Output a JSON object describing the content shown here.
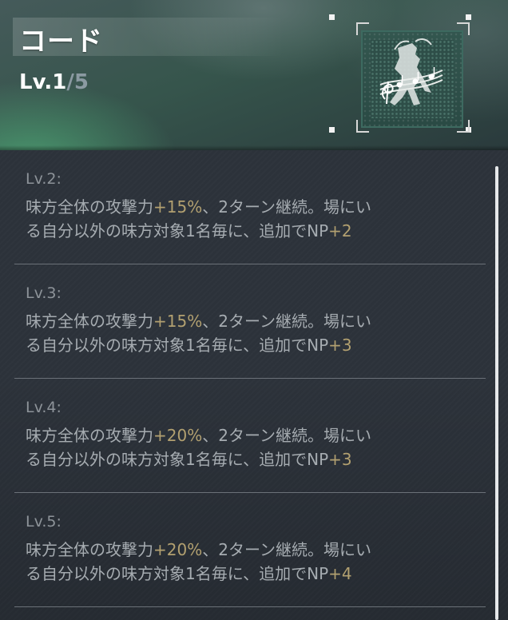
{
  "skill": {
    "name": "コード",
    "level_label": "Lv.1",
    "level_max": "/5",
    "icon": "music-note-figure-icon"
  },
  "levels": [
    {
      "label": "Lv.2:",
      "line1_pre": "味方全体の攻撃力",
      "line1_bonus": "+15%",
      "line1_post": "、2ターン継続。場にい",
      "line2_pre": "る自分以外の味方対象1名毎に、追加でNP",
      "line2_bonus": "+2"
    },
    {
      "label": "Lv.3:",
      "line1_pre": "味方全体の攻撃力",
      "line1_bonus": "+15%",
      "line1_post": "、2ターン継続。場にい",
      "line2_pre": "る自分以外の味方対象1名毎に、追加でNP",
      "line2_bonus": "+3"
    },
    {
      "label": "Lv.4:",
      "line1_pre": "味方全体の攻撃力",
      "line1_bonus": "+20%",
      "line1_post": "、2ターン継続。場にい",
      "line2_pre": "る自分以外の味方対象1名毎に、追加でNP",
      "line2_bonus": "+3"
    },
    {
      "label": "Lv.5:",
      "line1_pre": "味方全体の攻撃力",
      "line1_bonus": "+20%",
      "line1_post": "、2ターン継続。場にい",
      "line2_pre": "る自分以外の味方対象1名毎に、追加でNP",
      "line2_bonus": "+4"
    }
  ],
  "colors": {
    "highlight": "#b2a070",
    "text": "#a6acb1",
    "accent_green": "#3d6a60"
  }
}
